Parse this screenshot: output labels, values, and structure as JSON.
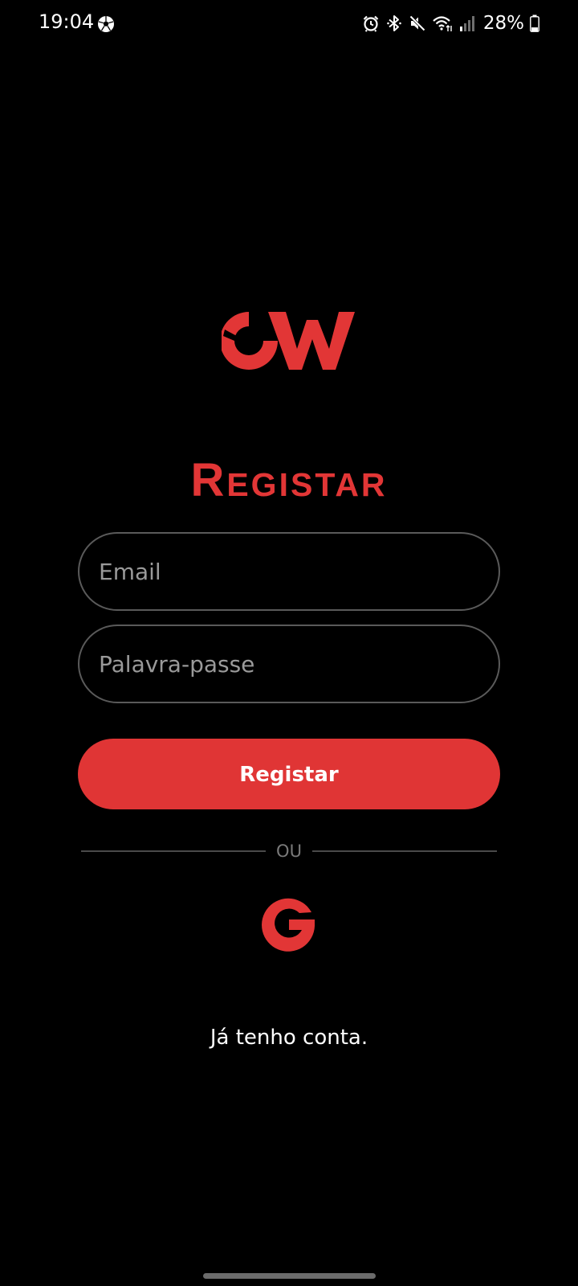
{
  "status_bar": {
    "time": "19:04",
    "left_icon": "soccer-ball-icon",
    "right_icons": [
      "alarm-icon",
      "bluetooth-icon",
      "mute-icon",
      "wifi-icon",
      "signal-icon"
    ],
    "battery_text": "28%",
    "battery_level": 0.28
  },
  "logo": {
    "text": "CW",
    "color": "#e23636"
  },
  "title": "Registar",
  "form": {
    "email": {
      "value": "",
      "placeholder": "Email"
    },
    "password": {
      "value": "",
      "placeholder": "Palavra-passe"
    },
    "submit_label": "Registar"
  },
  "divider_text": "OU",
  "google": {
    "icon": "google-icon"
  },
  "login_link": "Já tenho conta.",
  "colors": {
    "accent": "#e23636",
    "background": "#000000",
    "field_border": "#5a5a5a"
  }
}
